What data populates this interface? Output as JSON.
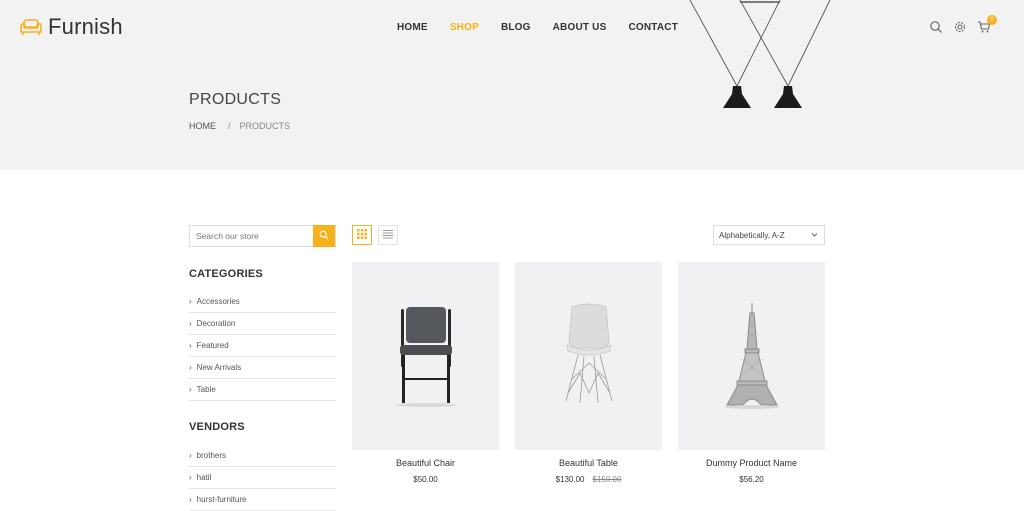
{
  "brand": {
    "name": "Furnish",
    "accent": "#f5b21b",
    "logo_icon": "sofa-icon"
  },
  "nav": {
    "items": [
      {
        "label": "HOME",
        "active": false
      },
      {
        "label": "SHOP",
        "active": true
      },
      {
        "label": "BLOG",
        "active": false
      },
      {
        "label": "ABOUT US",
        "active": false
      },
      {
        "label": "CONTACT",
        "active": false
      }
    ]
  },
  "header_icons": {
    "search": "search-icon",
    "settings": "gear-icon",
    "cart": "cart-icon",
    "cart_count": "0"
  },
  "hero": {
    "title": "PRODUCTS",
    "breadcrumb": {
      "home": "HOME",
      "separator": "/",
      "current": "PRODUCTS"
    }
  },
  "sidebar": {
    "search_placeholder": "Search our store",
    "categories_title": "CATEGORIES",
    "categories": [
      "Accessories",
      "Decoration",
      "Featured",
      "New Arrivals",
      "Table"
    ],
    "vendors_title": "VENDORS",
    "vendors": [
      "brothers",
      "hatil",
      "hurst-furniture"
    ]
  },
  "toolbar": {
    "grid_view_icon": "grid-view-icon",
    "list_view_icon": "list-view-icon",
    "sort_selected": "Alphabetically, A-Z"
  },
  "products": [
    {
      "name": "Beautiful Chair",
      "price": "$50.00",
      "old_price": ""
    },
    {
      "name": "Beautiful Table",
      "price": "$130.00",
      "old_price": "$150.00"
    },
    {
      "name": "Dummy Product Name",
      "price": "$56.20",
      "old_price": ""
    }
  ]
}
